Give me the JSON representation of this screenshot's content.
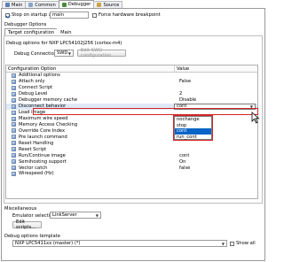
{
  "tabs": [
    {
      "label": "Main",
      "icon": "main-tab-icon",
      "active": false
    },
    {
      "label": "Common",
      "icon": "common-tab-icon",
      "active": false
    },
    {
      "label": "Debugger",
      "icon": "debugger-tab-icon",
      "active": true
    },
    {
      "label": "Source",
      "icon": "source-tab-icon",
      "active": false
    }
  ],
  "startup": {
    "stop_label": "Stop on startup at:",
    "stop_value": "main",
    "force_bp_label": "Force hardware breakpoint"
  },
  "debugger_options_label": "Debugger Options",
  "inner_tabs": [
    {
      "label": "Target configuration"
    },
    {
      "label": "Main"
    }
  ],
  "group_title": "Debug options for NXP LPC54102J256 (cortex-m4)",
  "debug_connection": {
    "label": "Debug Connection",
    "value": "SWD",
    "edit_button": "Edit SWD configuration"
  },
  "table": {
    "col1": "Configuration Option",
    "col2": "Value",
    "rows": [
      {
        "option": "Additional options",
        "value": ""
      },
      {
        "option": "Attach only",
        "value": "False"
      },
      {
        "option": "Connect Script",
        "value": ""
      },
      {
        "option": "Debug Level",
        "value": "2"
      },
      {
        "option": "Debugger memory cache",
        "value": "Disable"
      },
      {
        "option": "Disconnect behavior",
        "value": "cont"
      },
      {
        "option": "Load image",
        "value": ""
      },
      {
        "option": "Maximum wire speed",
        "value": ""
      },
      {
        "option": "Memory Access Checking",
        "value": ""
      },
      {
        "option": "Override Core Index",
        "value": ""
      },
      {
        "option": "Pre launch command",
        "value": ""
      },
      {
        "option": "Reset Handling",
        "value": ""
      },
      {
        "option": "Reset Script",
        "value": ""
      },
      {
        "option": "Run/Continue image",
        "value": "cont"
      },
      {
        "option": "Semihosting support",
        "value": "On"
      },
      {
        "option": "Vector catch",
        "value": "false"
      },
      {
        "option": "Wirespeed (Hz)",
        "value": ""
      }
    ],
    "dropdown_options": [
      "nochange",
      "stop",
      "cont",
      "run_cont"
    ],
    "dropdown_selected": "cont"
  },
  "misc": {
    "title": "Miscellaneous",
    "emulator_label": "Emulator selection",
    "emulator_value": "LinkServer",
    "edit_scripts": "Edit scripts..."
  },
  "template": {
    "title": "Debug options template",
    "value": "NXP LPC5411xx (master) (*)",
    "show_all": "Show all"
  },
  "colors": {
    "highlight_border": "#d62323",
    "selection_blue": "#0a64c8"
  }
}
